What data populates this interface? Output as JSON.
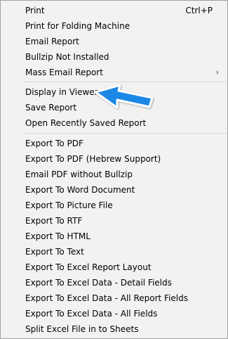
{
  "menu": {
    "group1": [
      {
        "label": "Print",
        "shortcut": "Ctrl+P"
      },
      {
        "label": "Print for Folding Machine"
      },
      {
        "label": "Email Report"
      },
      {
        "label": "Bullzip Not Installed"
      },
      {
        "label": "Mass Email Report",
        "submenu_indicator": "›"
      }
    ],
    "group2": [
      {
        "label": "Display in Viewer"
      },
      {
        "label": "Save Report"
      },
      {
        "label": "Open Recently Saved Report"
      }
    ],
    "group3": [
      {
        "label": "Export To PDF"
      },
      {
        "label": "Export To PDF (Hebrew Support)"
      },
      {
        "label": "Email PDF without Bullzip"
      },
      {
        "label": "Export To Word Document"
      },
      {
        "label": "Export To Picture File"
      },
      {
        "label": "Export To RTF"
      },
      {
        "label": "Export To HTML"
      },
      {
        "label": "Export To Text"
      },
      {
        "label": "Export To Excel Report Layout"
      },
      {
        "label": "Export To Excel Data - Detail Fields"
      },
      {
        "label": "Export To Excel Data - All Report Fields"
      },
      {
        "label": "Export To Excel Data - All Fields"
      },
      {
        "label": "Split Excel File in to Sheets"
      }
    ]
  },
  "colors": {
    "menu_background": "#f2f2f2",
    "separator": "#d7d7d7",
    "pointer_fill": "#1e88e5"
  },
  "annotation": {
    "icon": "blue-arrow-pointer-icon"
  }
}
